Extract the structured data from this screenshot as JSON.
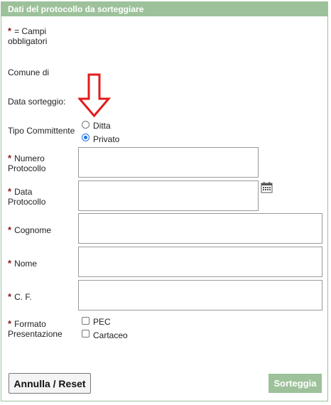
{
  "header": {
    "title": "Dati del protocollo da sorteggiare"
  },
  "required_note": {
    "star": "*",
    "text_line1": "= Campi",
    "text_line2": "obbligatori"
  },
  "fields": {
    "comune": {
      "label": "Comune di"
    },
    "data_sorteggio": {
      "label": "Data sorteggio:"
    },
    "tipo_committente": {
      "label": "Tipo Committente",
      "options": [
        {
          "label": "Ditta",
          "selected": false
        },
        {
          "label": "Privato",
          "selected": true
        }
      ]
    },
    "numero_protocollo": {
      "label_line1": "Numero",
      "label_line2": "Protocollo",
      "value": ""
    },
    "data_protocollo": {
      "label_line1": "Data",
      "label_line2": "Protocollo",
      "value": ""
    },
    "cognome": {
      "label": "Cognome",
      "value": ""
    },
    "nome": {
      "label": "Nome",
      "value": ""
    },
    "cf": {
      "label": "C. F.",
      "value": ""
    },
    "formato_presentazione": {
      "label_line1": "Formato",
      "label_line2": "Presentazione",
      "options": [
        {
          "label": "PEC",
          "checked": false
        },
        {
          "label": "Cartaceo",
          "checked": false
        }
      ]
    }
  },
  "buttons": {
    "reset": "Annulla / Reset",
    "submit": "Sorteggia"
  },
  "icons": {
    "calendar": "calendar-icon",
    "annotation_arrow": "down-arrow-annotation"
  },
  "colors": {
    "header_bg": "#9dc19a",
    "required_star": "#8b1a1a",
    "annotation_arrow": "#e31b1b",
    "radio_selected": "#1a73e8"
  }
}
